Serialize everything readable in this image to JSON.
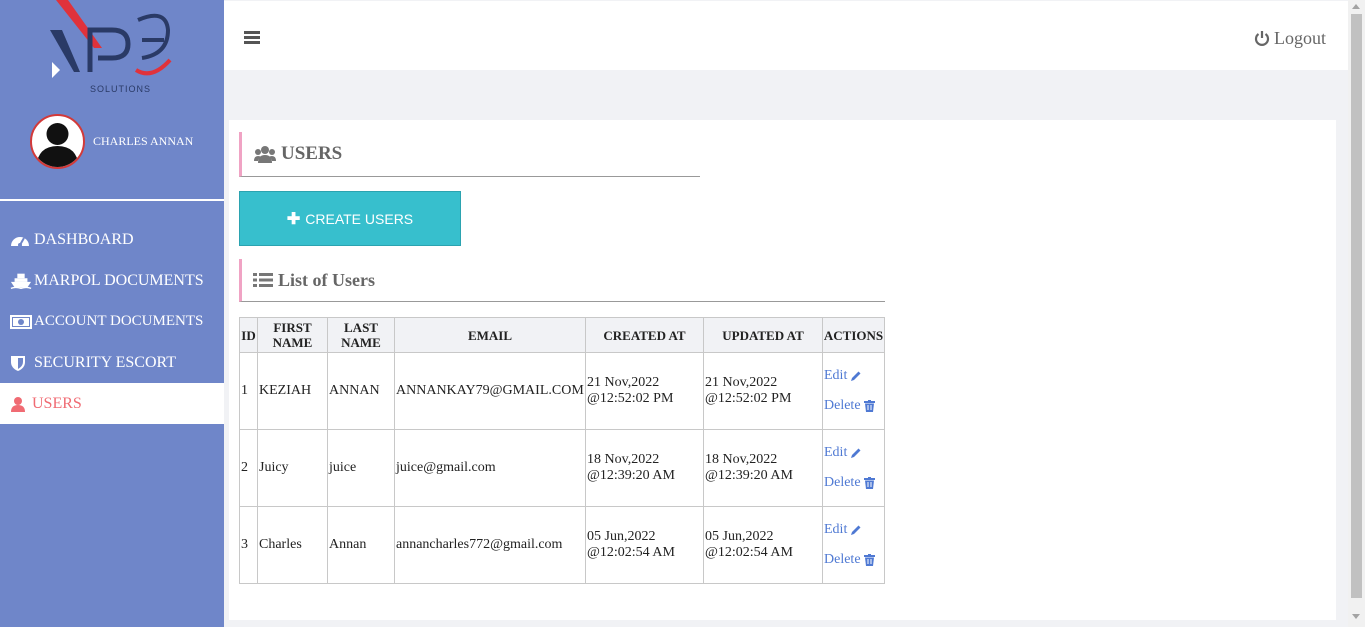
{
  "sidebar": {
    "logo_text": "SOLUTIONS",
    "profile_name": "CHARLES ANNAN",
    "items": [
      {
        "label": "DASHBOARD",
        "icon": "dashboard-icon"
      },
      {
        "label": "MARPOL DOCUMENTS",
        "icon": "ship-icon"
      },
      {
        "label": "ACCOUNT DOCUMENTS",
        "icon": "money-icon"
      },
      {
        "label": "SECURITY ESCORT",
        "icon": "shield-icon"
      },
      {
        "label": "USERS",
        "icon": "user-icon",
        "active": true
      }
    ]
  },
  "topbar": {
    "logout_label": "Logout"
  },
  "main": {
    "section_title": "USERS",
    "create_button_label": "CREATE USERS",
    "list_title": "List of Users",
    "table": {
      "headers": {
        "id": "ID",
        "first_name": "FIRST NAME",
        "last_name": "LAST NAME",
        "email": "EMAIL",
        "created_at": "CREATED AT",
        "updated_at": "UPDATED AT",
        "actions": "ACTIONS"
      },
      "rows": [
        {
          "id": "1",
          "first_name": "KEZIAH",
          "last_name": "ANNAN",
          "email": "ANNANKAY79@GMAIL.COM",
          "created_date": "21 Nov,2022",
          "created_time": "@12:52:02 PM",
          "updated_date": "21 Nov,2022",
          "updated_time": "@12:52:02 PM"
        },
        {
          "id": "2",
          "first_name": "Juicy",
          "last_name": "juice",
          "email": "juice@gmail.com",
          "created_date": "18 Nov,2022",
          "created_time": "@12:39:20 AM",
          "updated_date": "18 Nov,2022",
          "updated_time": "@12:39:20 AM"
        },
        {
          "id": "3",
          "first_name": "Charles",
          "last_name": "Annan",
          "email": "annancharles772@gmail.com",
          "created_date": "05 Jun,2022",
          "created_time": "@12:02:54 AM",
          "updated_date": "05 Jun,2022",
          "updated_time": "@12:02:54 AM"
        }
      ],
      "edit_label": "Edit",
      "delete_label": "Delete"
    }
  },
  "colors": {
    "sidebar_bg": "#6f86c9",
    "active_text": "#f06b73",
    "create_button": "#37bfcd",
    "link": "#4f79d3",
    "section_accent": "#f0a3c4"
  }
}
